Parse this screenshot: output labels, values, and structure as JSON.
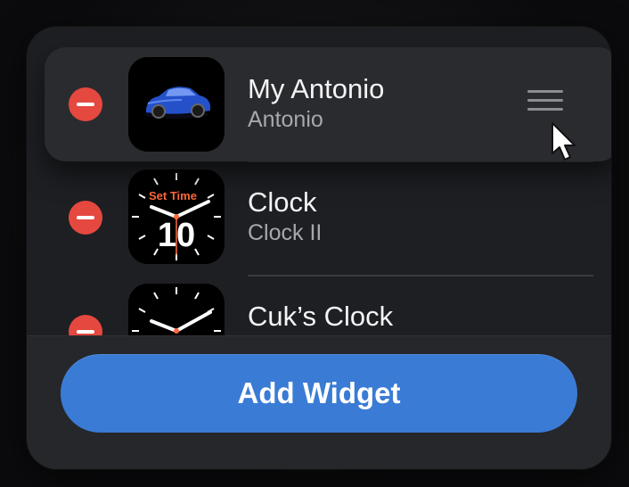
{
  "widgets": [
    {
      "title": "My Antonio",
      "subtitle": "Antonio",
      "icon": "car-icon",
      "state": "dragging"
    },
    {
      "title": "Clock",
      "subtitle": "Clock II",
      "icon": "clock-face-icon",
      "face_label": "Set Time",
      "face_number": "10"
    },
    {
      "title": "Cuk’s Clock",
      "subtitle": "",
      "icon": "analog-clock-icon"
    }
  ],
  "footer": {
    "add_label": "Add Widget"
  },
  "colors": {
    "remove": "#e5483f",
    "accent": "#3a7bd5",
    "panel": "#1e1f23"
  }
}
